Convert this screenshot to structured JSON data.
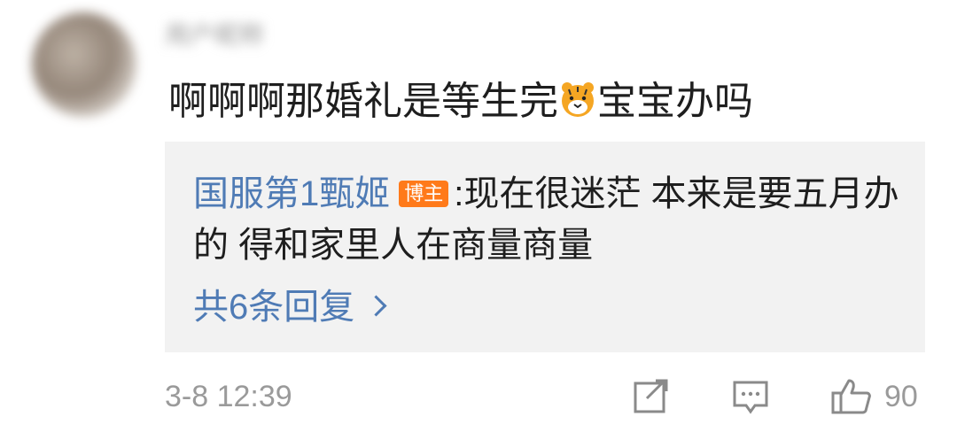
{
  "comment": {
    "username": "用户昵称",
    "text_before_emoji": "啊啊啊那婚礼是等生完",
    "emoji": "tiger-face-icon",
    "text_after_emoji": "宝宝办吗",
    "timestamp": "3-8 12:39",
    "like_count": "90"
  },
  "reply": {
    "author": "国服第1甄姬",
    "badge": "博主",
    "separator": ":",
    "text": "现在很迷茫 本来是要五月办的 得和家里人在商量商量",
    "more_label": "共6条回复"
  },
  "colors": {
    "link": "#4f7bb5",
    "badge": "#ff7a1a",
    "muted": "#9a9a9a",
    "reply_bg": "#f2f2f2"
  }
}
